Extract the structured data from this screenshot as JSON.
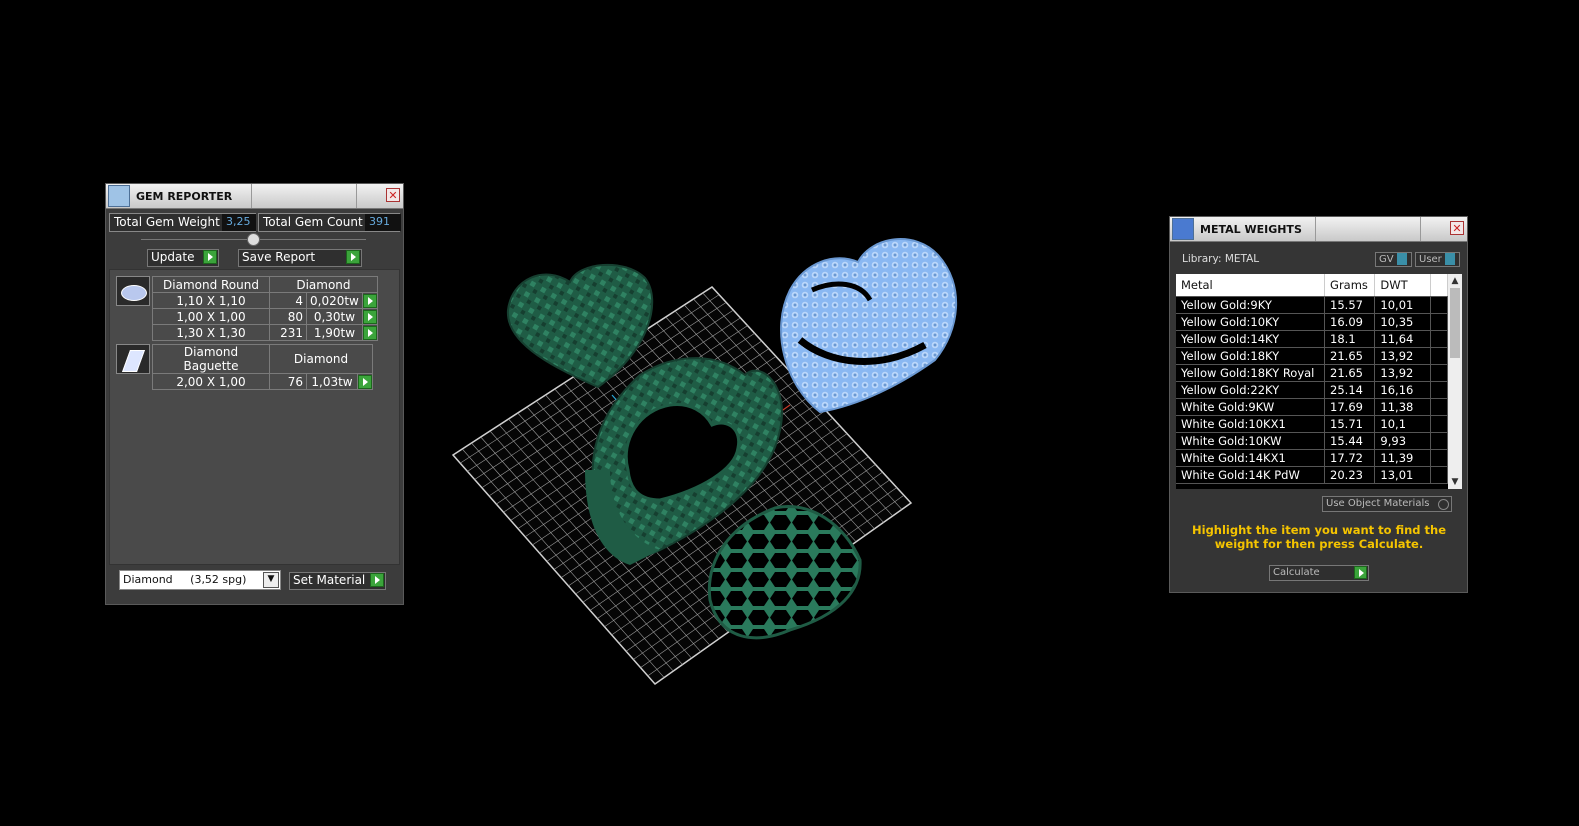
{
  "gem_reporter": {
    "title": "GEM REPORTER",
    "total_weight_label": "Total Gem Weight",
    "total_weight_value": "3,25",
    "total_count_label": "Total Gem Count",
    "total_count_value": "391",
    "update_label": "Update",
    "save_report_label": "Save Report",
    "groups": [
      {
        "shape": "Diamond Round",
        "material": "Diamond",
        "rows": [
          {
            "size": "1,10 X 1,10",
            "count": "4",
            "weight": "0,020tw"
          },
          {
            "size": "1,00 X 1,00",
            "count": "80",
            "weight": "0,30tw"
          },
          {
            "size": "1,30 X 1,30",
            "count": "231",
            "weight": "1,90tw"
          }
        ]
      },
      {
        "shape": "Diamond Baguette",
        "material": "Diamond",
        "rows": [
          {
            "size": "2,00 X 1,00",
            "count": "76",
            "weight": "1,03tw"
          }
        ]
      }
    ],
    "material_select": "Diamond     (3,52 spg)",
    "set_material_label": "Set Material"
  },
  "metal_weights": {
    "title": "METAL WEIGHTS",
    "library_label": "Library: METAL",
    "gv_label": "GV",
    "user_label": "User",
    "columns": [
      "Metal",
      "Grams",
      "DWT"
    ],
    "rows": [
      [
        "Yellow Gold:9KY",
        "15.57",
        "10,01"
      ],
      [
        "Yellow Gold:10KY",
        "16.09",
        "10,35"
      ],
      [
        "Yellow Gold:14KY",
        "18.1",
        "11,64"
      ],
      [
        "Yellow Gold:18KY",
        "21.65",
        "13,92"
      ],
      [
        "Yellow Gold:18KY Royal",
        "21.65",
        "13,92"
      ],
      [
        "Yellow Gold:22KY",
        "25.14",
        "16,16"
      ],
      [
        "White Gold:9KW",
        "17.69",
        "11,38"
      ],
      [
        "White Gold:10KX1",
        "15.71",
        "10,1"
      ],
      [
        "White Gold:10KW",
        "15.44",
        "9,93"
      ],
      [
        "White Gold:14KX1",
        "17.72",
        "11,39"
      ],
      [
        "White Gold:14K PdW",
        "20.23",
        "13,01"
      ]
    ],
    "use_object_label": "Use Object Materials",
    "hint": "Highlight the item you want to find the weight for then press Calculate.",
    "calculate_label": "Calculate",
    "hint_color": "#f5c400"
  },
  "viewport": {
    "model_color": "#1f5c45",
    "selected_color": "#8ab8f2",
    "grid_color": "#bdbdbd"
  }
}
